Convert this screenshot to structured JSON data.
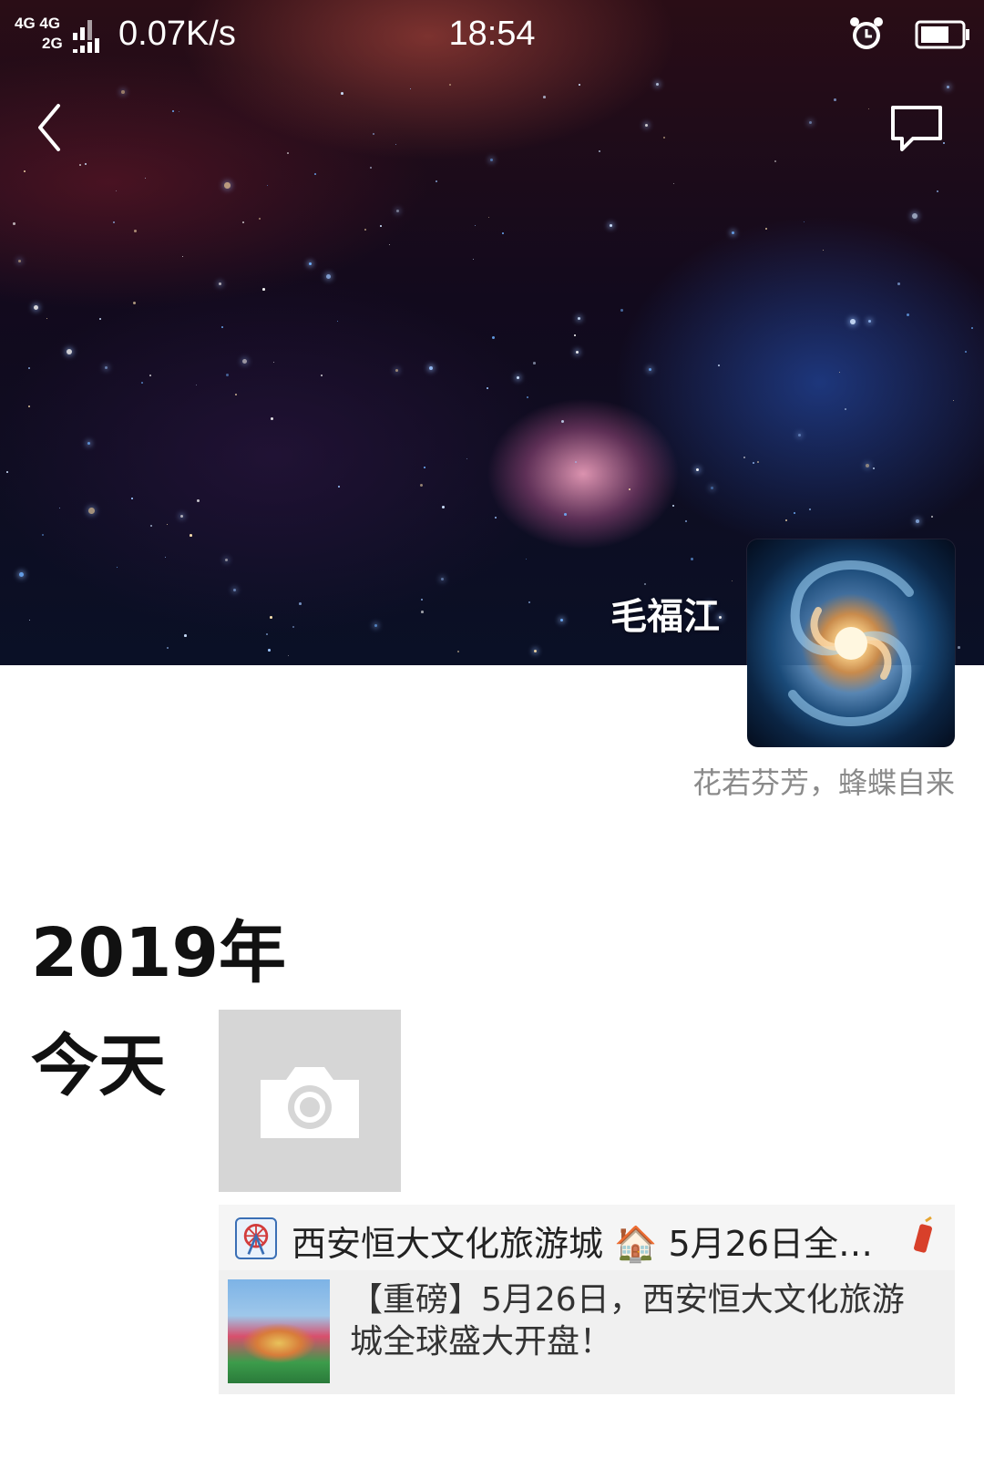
{
  "status_bar": {
    "signal_top": "4G 4G",
    "signal_bottom": "2G",
    "net_speed": "0.07K/s",
    "time": "18:54",
    "alarm_icon": "alarm-clock-icon",
    "battery_icon": "battery-icon"
  },
  "nav": {
    "back_icon": "chevron-left-icon",
    "message_icon": "chat-bubble-icon"
  },
  "profile": {
    "name": "毛福江",
    "signature": "花若芬芳，蜂蝶自来"
  },
  "timeline": {
    "year": "2019年",
    "day": "今天",
    "camera_icon": "camera-icon",
    "post": {
      "title": "西安恒大文化旅游城 🏠 5月26日全…",
      "link_title": "【重磅】5月26日，西安恒大文化旅游城全球盛大开盘！"
    }
  },
  "colors": {
    "signature_gray": "#8a8a8a",
    "card_bg": "#f0f0f0",
    "camera_tile": "#d6d6d6"
  }
}
